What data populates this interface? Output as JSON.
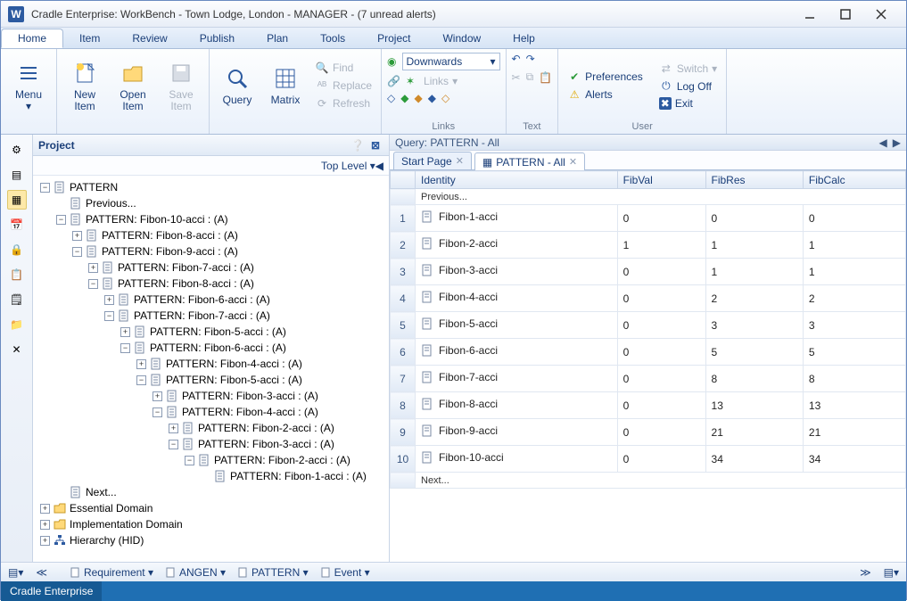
{
  "window": {
    "title": "Cradle Enterprise: WorkBench - Town Lodge, London - MANAGER - (7 unread alerts)",
    "app_icon_letter": "W"
  },
  "menu": {
    "items": [
      "Home",
      "Item",
      "Review",
      "Publish",
      "Plan",
      "Tools",
      "Project",
      "Window",
      "Help"
    ],
    "active": 0
  },
  "ribbon": {
    "menu_label": "Menu",
    "new_item": "New\nItem",
    "open_item": "Open\nItem",
    "save_item": "Save\nItem",
    "query": "Query",
    "matrix": "Matrix",
    "find": "Find",
    "replace": "Replace",
    "refresh": "Refresh",
    "downwards": "Downwards",
    "links_dd": "Links",
    "links_group": "Links",
    "text_group": "Text",
    "user_group": "User",
    "preferences": "Preferences",
    "alerts": "Alerts",
    "switch": "Switch",
    "logoff": "Log Off",
    "exit": "Exit"
  },
  "project_pane": {
    "title": "Project",
    "top_level": "Top Level",
    "tree": [
      {
        "indent": 0,
        "exp": "-",
        "icon": "doc",
        "label": "PATTERN"
      },
      {
        "indent": 1,
        "exp": "",
        "icon": "doc",
        "label": "Previous..."
      },
      {
        "indent": 1,
        "exp": "-",
        "icon": "doc",
        "label": "PATTERN: Fibon-10-acci :  (A)"
      },
      {
        "indent": 2,
        "exp": "+",
        "icon": "doc",
        "label": "PATTERN: Fibon-8-acci :  (A)"
      },
      {
        "indent": 2,
        "exp": "-",
        "icon": "doc",
        "label": "PATTERN: Fibon-9-acci :  (A)"
      },
      {
        "indent": 3,
        "exp": "+",
        "icon": "doc",
        "label": "PATTERN: Fibon-7-acci :  (A)"
      },
      {
        "indent": 3,
        "exp": "-",
        "icon": "doc",
        "label": "PATTERN: Fibon-8-acci :  (A)"
      },
      {
        "indent": 4,
        "exp": "+",
        "icon": "doc",
        "label": "PATTERN: Fibon-6-acci :  (A)"
      },
      {
        "indent": 4,
        "exp": "-",
        "icon": "doc",
        "label": "PATTERN: Fibon-7-acci :  (A)"
      },
      {
        "indent": 5,
        "exp": "+",
        "icon": "doc",
        "label": "PATTERN: Fibon-5-acci :  (A)"
      },
      {
        "indent": 5,
        "exp": "-",
        "icon": "doc",
        "label": "PATTERN: Fibon-6-acci :  (A)"
      },
      {
        "indent": 6,
        "exp": "+",
        "icon": "doc",
        "label": "PATTERN: Fibon-4-acci :  (A)"
      },
      {
        "indent": 6,
        "exp": "-",
        "icon": "doc",
        "label": "PATTERN: Fibon-5-acci :  (A)"
      },
      {
        "indent": 7,
        "exp": "+",
        "icon": "doc",
        "label": "PATTERN: Fibon-3-acci :  (A)"
      },
      {
        "indent": 7,
        "exp": "-",
        "icon": "doc",
        "label": "PATTERN: Fibon-4-acci :  (A)"
      },
      {
        "indent": 8,
        "exp": "+",
        "icon": "doc",
        "label": "PATTERN: Fibon-2-acci :  (A)"
      },
      {
        "indent": 8,
        "exp": "-",
        "icon": "doc",
        "label": "PATTERN: Fibon-3-acci :  (A)"
      },
      {
        "indent": 9,
        "exp": "-",
        "icon": "doc",
        "label": "PATTERN: Fibon-2-acci :  (A)"
      },
      {
        "indent": 10,
        "exp": "",
        "icon": "doc",
        "label": "PATTERN: Fibon-1-acci :  (A)"
      },
      {
        "indent": 1,
        "exp": "",
        "icon": "doc",
        "label": "Next..."
      },
      {
        "indent": 0,
        "exp": "+",
        "icon": "folder",
        "label": "Essential Domain"
      },
      {
        "indent": 0,
        "exp": "+",
        "icon": "folder",
        "label": "Implementation Domain"
      },
      {
        "indent": 0,
        "exp": "+",
        "icon": "hier",
        "label": "Hierarchy (HID)"
      }
    ]
  },
  "query_pane": {
    "header": "Query: PATTERN - All",
    "tabs": [
      {
        "label": "Start Page",
        "active": false
      },
      {
        "label": "PATTERN - All",
        "active": true
      }
    ],
    "columns": [
      "",
      "Identity",
      "FibVal",
      "FibRes",
      "FibCalc"
    ],
    "previous": "Previous...",
    "next": "Next...",
    "rows": [
      {
        "n": 1,
        "identity": "Fibon-1-acci",
        "fibval": "0",
        "fibres": "0",
        "fibcalc": "0"
      },
      {
        "n": 2,
        "identity": "Fibon-2-acci",
        "fibval": "1",
        "fibres": "1",
        "fibcalc": "1"
      },
      {
        "n": 3,
        "identity": "Fibon-3-acci",
        "fibval": "0",
        "fibres": "1",
        "fibcalc": "1"
      },
      {
        "n": 4,
        "identity": "Fibon-4-acci",
        "fibval": "0",
        "fibres": "2",
        "fibcalc": "2"
      },
      {
        "n": 5,
        "identity": "Fibon-5-acci",
        "fibval": "0",
        "fibres": "3",
        "fibcalc": "3"
      },
      {
        "n": 6,
        "identity": "Fibon-6-acci",
        "fibval": "0",
        "fibres": "5",
        "fibcalc": "5"
      },
      {
        "n": 7,
        "identity": "Fibon-7-acci",
        "fibval": "0",
        "fibres": "8",
        "fibcalc": "8"
      },
      {
        "n": 8,
        "identity": "Fibon-8-acci",
        "fibval": "0",
        "fibres": "13",
        "fibcalc": "13"
      },
      {
        "n": 9,
        "identity": "Fibon-9-acci",
        "fibval": "0",
        "fibres": "21",
        "fibcalc": "21"
      },
      {
        "n": 10,
        "identity": "Fibon-10-acci",
        "fibval": "0",
        "fibres": "34",
        "fibcalc": "34"
      }
    ]
  },
  "bottom_toolbar": {
    "items": [
      "Requirement",
      "ANGEN",
      "PATTERN",
      "Event"
    ]
  },
  "status": {
    "label": "Cradle Enterprise"
  }
}
